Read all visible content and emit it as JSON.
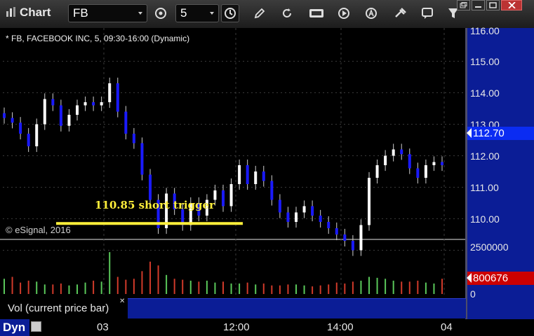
{
  "app": {
    "title": "Chart"
  },
  "toolbar": {
    "symbol": "FB",
    "interval": "5",
    "icons": [
      "timeframe-icon",
      "clock-icon",
      "draw-icon",
      "refresh-icon",
      "cursor-data-icon",
      "play-icon",
      "alert-icon",
      "tools-icon",
      "chat-icon",
      "filter-icon"
    ]
  },
  "chart": {
    "info": "* FB, FACEBOOK INC, 5, 09:30-16:00 (Dynamic)",
    "copyright": "© eSignal, 2016",
    "annotation": "110.85 short trigger",
    "trigger_price": 110.85,
    "price_axis": [
      "116.00",
      "115.00",
      "114.00",
      "113.00",
      "112.00",
      "111.00",
      "110.00"
    ],
    "last_price": "112.70",
    "volume_axis": [
      "2500000",
      "0"
    ],
    "last_volume": "800676",
    "volume_label": "Vol (current price bar)",
    "x_labels": [
      "03",
      "12:00",
      "14:00",
      "04"
    ],
    "mode": "Dyn",
    "colors": {
      "up_bar": "#ffffff",
      "down_bar": "#1a1aff",
      "trigger_line": "#ffef3a",
      "price_tag": "#0b2cf2",
      "volume_tag": "#cc0000",
      "vol_up": "#5ac85a",
      "vol_down": "#d03a2a"
    }
  },
  "chart_data": {
    "type": "candlestick",
    "price_range": [
      109.6,
      116.05
    ],
    "closes": [
      114.2,
      114.05,
      113.7,
      113.3,
      114.0,
      114.8,
      114.6,
      113.95,
      114.3,
      114.6,
      114.7,
      114.6,
      114.7,
      115.3,
      114.4,
      113.7,
      113.4,
      112.4,
      111.6,
      110.7,
      111.8,
      111.3,
      110.8,
      111.5,
      111.1,
      111.6,
      111.9,
      111.4,
      112.1,
      112.7,
      112.1,
      112.5,
      112.2,
      111.6,
      111.2,
      110.9,
      111.2,
      111.4,
      111.1,
      110.9,
      110.7,
      110.5,
      110.3,
      110.0,
      110.8,
      112.3,
      112.7,
      113.0,
      113.2,
      113.05,
      112.6,
      112.3,
      112.7,
      112.8,
      112.7
    ],
    "volume_scale": [
      0,
      2500000
    ],
    "volumes": [
      800000,
      900000,
      600000,
      700000,
      650000,
      500000,
      500000,
      550000,
      450000,
      500000,
      600000,
      700000,
      650000,
      2200000,
      900000,
      750000,
      800000,
      1200000,
      1700000,
      1500000,
      1000000,
      800000,
      750000,
      700000,
      650000,
      700000,
      600000,
      650000,
      550000,
      550000,
      600000,
      500000,
      550000,
      450000,
      450000,
      500000,
      500000,
      450000,
      400000,
      450000,
      500000,
      600000,
      550000,
      650000,
      700000,
      900000,
      850000,
      800000,
      700000,
      650000,
      650000,
      700000,
      600000,
      550000,
      800676
    ]
  }
}
